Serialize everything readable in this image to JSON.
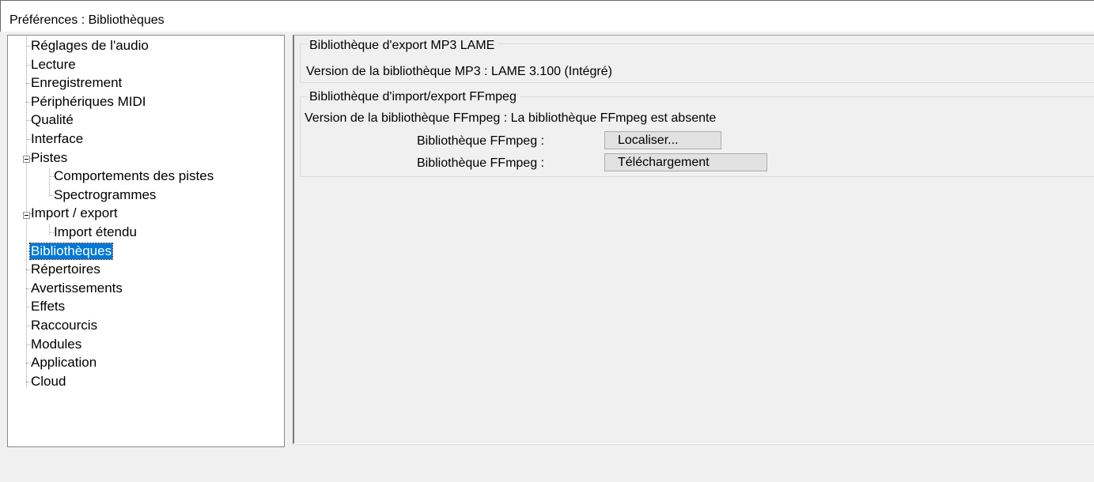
{
  "window": {
    "title": "Préférences : Bibliothèques"
  },
  "tree": {
    "items": [
      {
        "label": "Réglages de l'audio",
        "level": 0
      },
      {
        "label": "Lecture",
        "level": 0
      },
      {
        "label": "Enregistrement",
        "level": 0
      },
      {
        "label": "Périphériques MIDI",
        "level": 0
      },
      {
        "label": "Qualité",
        "level": 0
      },
      {
        "label": "Interface",
        "level": 0
      },
      {
        "label": "Pistes",
        "level": 0,
        "expanded": true
      },
      {
        "label": "Comportements des pistes",
        "level": 1
      },
      {
        "label": "Spectrogrammes",
        "level": 1
      },
      {
        "label": "Import / export",
        "level": 0,
        "expanded": true
      },
      {
        "label": "Import étendu",
        "level": 1
      },
      {
        "label": "Bibliothèques",
        "level": 0,
        "selected": true
      },
      {
        "label": "Répertoires",
        "level": 0
      },
      {
        "label": "Avertissements",
        "level": 0
      },
      {
        "label": "Effets",
        "level": 0
      },
      {
        "label": "Raccourcis",
        "level": 0
      },
      {
        "label": "Modules",
        "level": 0
      },
      {
        "label": "Application",
        "level": 0
      },
      {
        "label": "Cloud",
        "level": 0
      }
    ]
  },
  "mp3_group": {
    "caption": "Bibliothèque d'export MP3 LAME",
    "version_text": "Version de la bibliothèque MP3 : LAME 3.100 (Intégré)"
  },
  "ffmpeg_group": {
    "caption": "Bibliothèque d'import/export FFmpeg",
    "version_text": "Version de la bibliothèque FFmpeg : La bibliothèque FFmpeg est absente",
    "locate_label": "Bibliothèque FFmpeg :",
    "locate_button": "Localiser...",
    "download_label": "Bibliothèque FFmpeg :",
    "download_button": "Téléchargement"
  },
  "colors": {
    "selection": "#0078d7",
    "panel_bg": "#f0f0f0",
    "tree_bg": "#ffffff"
  }
}
